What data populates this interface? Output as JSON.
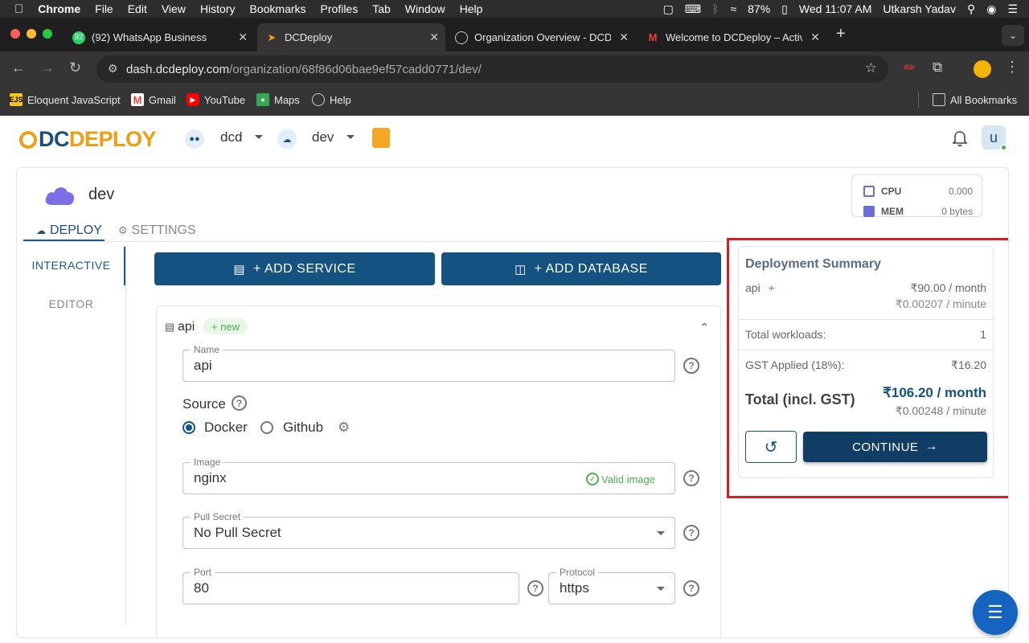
{
  "menubar": {
    "app": "Chrome",
    "items": [
      "File",
      "Edit",
      "View",
      "History",
      "Bookmarks",
      "Profiles",
      "Tab",
      "Window",
      "Help"
    ],
    "battery": "87%",
    "datetime": "Wed 11:07 AM",
    "user": "Utkarsh Yadav"
  },
  "tabs": [
    {
      "title": "(92) WhatsApp Business",
      "badge": "92"
    },
    {
      "title": "DCDeploy"
    },
    {
      "title": "Organization Overview - DCD"
    },
    {
      "title": "Welcome to DCDeploy – Activ"
    }
  ],
  "omnibox": {
    "domain": "dash.dcdeploy.com",
    "path": "/organization/68f86d06bae9ef57cadd0771/dev/"
  },
  "bookmarks": [
    {
      "label": "Eloquent JavaScript",
      "icon": "EJS"
    },
    {
      "label": "Gmail",
      "icon": "gmail-icon"
    },
    {
      "label": "YouTube",
      "icon": "youtube-icon"
    },
    {
      "label": "Maps",
      "icon": "maps-icon"
    },
    {
      "label": "Help",
      "icon": "help-icon"
    }
  ],
  "all_bookmarks": "All Bookmarks",
  "app": {
    "logo_dc": "DC",
    "logo_deploy": "DEPLOY",
    "org": "dcd",
    "env": "dev",
    "avatar": "u"
  },
  "env": {
    "name": "dev",
    "cpu_label": "CPU",
    "cpu_value": "0.000",
    "mem_label": "MEM",
    "mem_value": "0 bytes"
  },
  "page_tabs": {
    "deploy": "DEPLOY",
    "settings": "SETTINGS"
  },
  "side_tabs": {
    "interactive": "INTERACTIVE",
    "editor": "EDITOR"
  },
  "buttons": {
    "add_service": "+ ADD SERVICE",
    "add_database": "+ ADD DATABASE"
  },
  "service": {
    "name": "api",
    "badge": "+ new",
    "name_label": "Name",
    "name_value": "api",
    "source_label": "Source",
    "source_docker": "Docker",
    "source_github": "Github",
    "source_selected": "Docker",
    "image_label": "Image",
    "image_value": "nginx",
    "image_status": "Valid image",
    "pull_secret_label": "Pull Secret",
    "pull_secret_value": "No Pull Secret",
    "port_label": "Port",
    "port_value": "80",
    "protocol_label": "Protocol",
    "protocol_value": "https"
  },
  "summary": {
    "title": "Deployment Summary",
    "item_name": "api",
    "item_plus": "+",
    "item_month": "₹90.00 / month",
    "item_minute": "₹0.00207 / minute",
    "workloads_label": "Total workloads:",
    "workloads_value": "1",
    "gst_label": "GST Applied (18%):",
    "gst_value": "₹16.20",
    "total_label": "Total (incl. GST)",
    "total_month": "₹106.20 / month",
    "total_minute": "₹0.00248 / minute",
    "continue": "CONTINUE"
  },
  "colors": {
    "primary": "#145282",
    "accent": "#f39c12",
    "highlight": "#d32027",
    "success": "#4caf50"
  }
}
